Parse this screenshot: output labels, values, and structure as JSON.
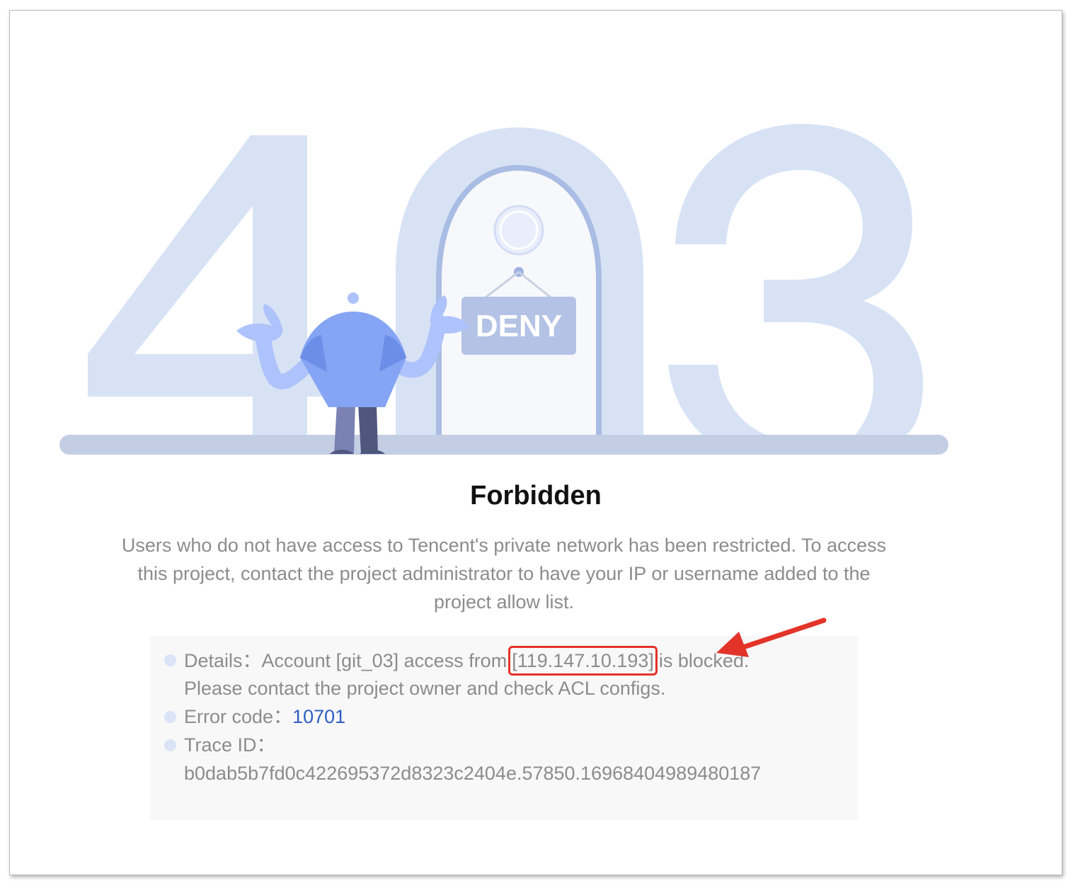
{
  "illustration": {
    "big_digits": "403",
    "sign_text": "DENY"
  },
  "title": "Forbidden",
  "description": "Users who do not have access to Tencent's private network has been restricted. To access this project, contact the project administrator to have your IP or username added to the project allow list.",
  "details": {
    "line1_prefix": "Details：Account [git_03] access from",
    "ip": "[119.147.10.193]",
    "line1_suffix": "is blocked.",
    "line2": "Please contact the project owner and check ACL configs.",
    "error_code_label": "Error code：",
    "error_code_value": "10701",
    "trace_label": "Trace ID：",
    "trace_value": "b0dab5b7fd0c422695372d8323c2404e.57850.16968404989480187"
  },
  "colors": {
    "digits": "#d8e2f5",
    "ground": "#c3cde3",
    "sign": "#b3c2e5",
    "shirt": "#85a4f3",
    "arms": "#aec3fb",
    "annotation": "#e3342a",
    "link": "#2e5fc2"
  }
}
